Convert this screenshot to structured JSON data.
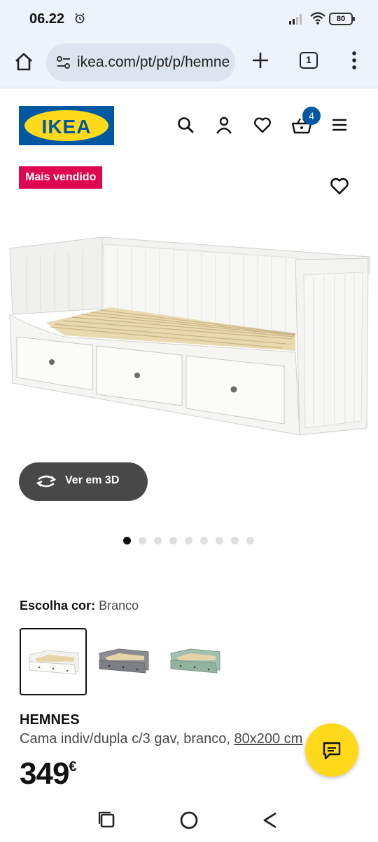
{
  "status_bar": {
    "time": "06.22",
    "battery": "80",
    "icons": [
      "alarm-icon",
      "signal-icon",
      "wifi-icon",
      "battery-icon"
    ]
  },
  "browser": {
    "url": "ikea.com/pt/pt/p/hemnes",
    "tab_count": "1",
    "icons": [
      "home-icon",
      "site-settings-icon",
      "plus-icon",
      "tabs-icon",
      "more-vertical-icon"
    ]
  },
  "header": {
    "logo_text": "IKEA",
    "cart_count": "4",
    "icons": [
      "search-icon",
      "user-icon",
      "heart-icon",
      "cart-icon",
      "hamburger-menu-icon"
    ],
    "colors": {
      "ikea_blue": "#0058a3",
      "ikea_yellow": "#ffda1a"
    }
  },
  "product": {
    "badge": "Mais vendido",
    "badge_color": "#e00751",
    "view_3d_label": "Ver em 3D",
    "gallery_dot_count": 9,
    "gallery_active_index": 0,
    "color_prompt": "Escolha cor:",
    "color_selected": "Branco",
    "swatches": [
      {
        "name": "white-swatch",
        "color": "#f4f4f2"
      },
      {
        "name": "grey-swatch",
        "color": "#7d7f84"
      },
      {
        "name": "green-swatch",
        "color": "#93b3a2"
      }
    ],
    "name": "HEMNES",
    "description_prefix": "Cama indiv/dupla c/3 gav, branco, ",
    "description_size": "80x200 cm",
    "price": "349",
    "currency": "€"
  },
  "nav_bar": {
    "icons": [
      "recents-icon",
      "home-circle-icon",
      "back-icon"
    ]
  }
}
